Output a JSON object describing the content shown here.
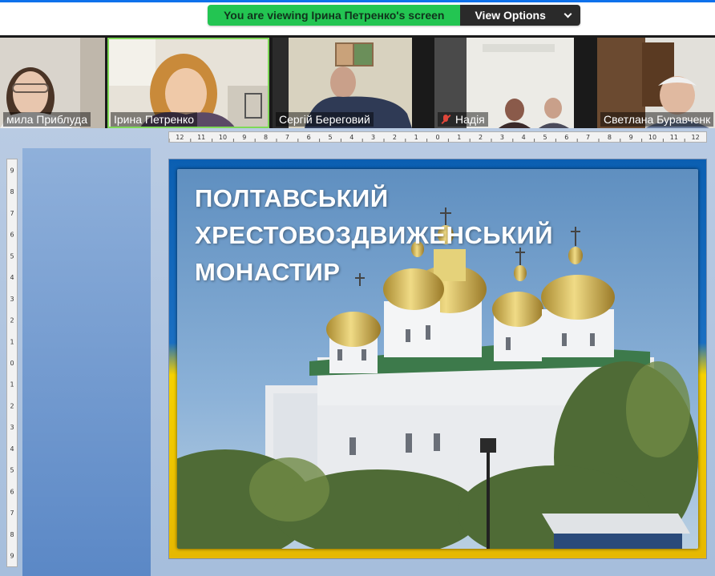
{
  "banner": {
    "share_text": "You are viewing Ірина Петренко's screen",
    "view_options_label": "View Options"
  },
  "participants": [
    {
      "name": "Людмила Приблуда",
      "shown": "мила Приблуда",
      "muted": false,
      "active": false
    },
    {
      "name": "Ірина Петренко",
      "shown": "Ірина Петренко",
      "muted": false,
      "active": true
    },
    {
      "name": "Сергій Береговий",
      "shown": "Сергій Береговий",
      "muted": false,
      "active": false
    },
    {
      "name": "Надія",
      "shown": "Надія",
      "muted": true,
      "active": false
    },
    {
      "name": "Светлана Буравченко",
      "shown": "Светлана Буравченк",
      "muted": false,
      "active": false
    }
  ],
  "ruler": {
    "horizontal": [
      "12",
      "11",
      "10",
      "9",
      "8",
      "7",
      "6",
      "5",
      "4",
      "3",
      "2",
      "1",
      "0",
      "1",
      "2",
      "3",
      "4",
      "5",
      "6",
      "7",
      "8",
      "9",
      "10",
      "11",
      "12"
    ],
    "vertical": [
      "9",
      "8",
      "7",
      "6",
      "5",
      "4",
      "3",
      "2",
      "1",
      "0",
      "1",
      "2",
      "3",
      "4",
      "5",
      "6",
      "7",
      "8",
      "9"
    ]
  },
  "slide": {
    "title_line1": "ПОЛТАВСЬКИЙ",
    "title_line2": "ХРЕСТОВОЗДВИЖЕНСЬКИЙ",
    "title_line3": "МОНАСТИР"
  },
  "colors": {
    "zoom_green": "#23c552",
    "zoom_dark": "#2a2a2a",
    "flag_blue": "#0b5fb2",
    "flag_yellow": "#f5d100",
    "sky": "#6f9cc8",
    "dome_gold": "#d9b84a",
    "roof_green": "#3d7a4b"
  }
}
